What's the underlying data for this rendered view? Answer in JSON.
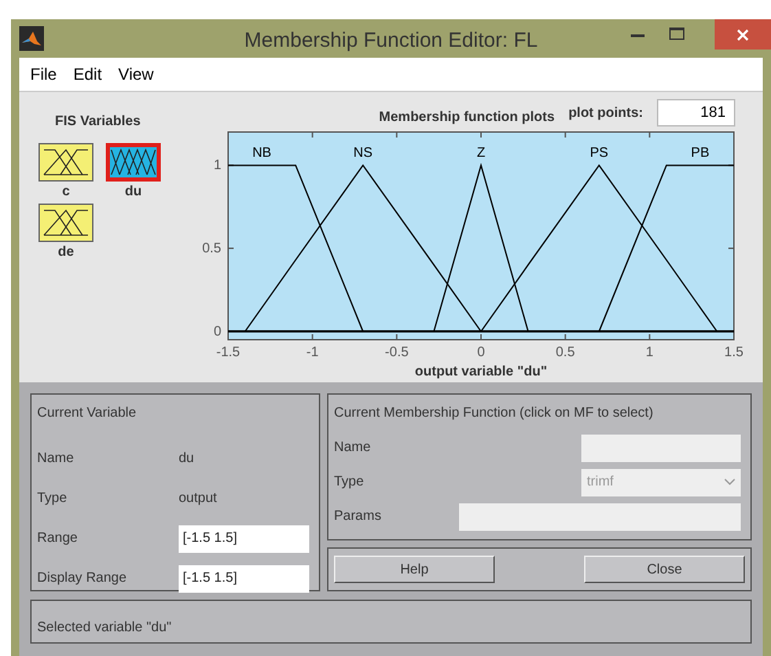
{
  "window": {
    "title": "Membership Function Editor: FL"
  },
  "menu": [
    "File",
    "Edit",
    "View"
  ],
  "fis_variables": {
    "title": "FIS Variables",
    "items": [
      {
        "name": "c",
        "kind": "input",
        "selected": false
      },
      {
        "name": "du",
        "kind": "output",
        "selected": true
      },
      {
        "name": "de",
        "kind": "input",
        "selected": false
      }
    ]
  },
  "plot_header": {
    "title": "Membership function plots",
    "points_label": "plot points:",
    "points_value": "181"
  },
  "chart_data": {
    "type": "line",
    "xlabel": "output variable \"du\"",
    "x": [
      -1.5,
      -1.4,
      -1.1,
      -0.7,
      -0.28,
      0,
      0.28,
      0.7,
      1.1,
      1.4,
      1.5
    ],
    "xlim": [
      -1.5,
      1.5
    ],
    "ylim": [
      -0.05,
      1.2
    ],
    "xticks": [
      -1.5,
      -1,
      -0.5,
      0,
      0.5,
      1,
      1.5
    ],
    "yticks": [
      0,
      0.5,
      1
    ],
    "series": [
      {
        "name": "NB",
        "color": "#000000",
        "values": [
          1,
          1,
          1,
          0,
          null,
          null,
          null,
          null,
          null,
          null,
          null
        ]
      },
      {
        "name": "NS",
        "color": "#000000",
        "values": [
          null,
          0,
          0.43,
          1,
          0.4,
          0,
          null,
          null,
          null,
          null,
          null
        ]
      },
      {
        "name": "Z",
        "color": "#000000",
        "values": [
          null,
          null,
          null,
          null,
          0,
          1,
          0,
          null,
          null,
          null,
          null
        ]
      },
      {
        "name": "PS",
        "color": "#000000",
        "values": [
          null,
          null,
          null,
          null,
          null,
          0,
          0.4,
          1,
          0.43,
          0,
          null
        ]
      },
      {
        "name": "PB",
        "color": "#000000",
        "values": [
          null,
          null,
          null,
          null,
          null,
          null,
          null,
          0,
          1,
          1,
          1
        ]
      }
    ]
  },
  "current_variable": {
    "title": "Current Variable",
    "rows": [
      {
        "kind": "text",
        "label": "Name",
        "value": "du"
      },
      {
        "kind": "text",
        "label": "Type",
        "value": "output"
      },
      {
        "kind": "field",
        "label": "Range",
        "value": "[-1.5 1.5]"
      },
      {
        "kind": "field",
        "label": "Display Range",
        "value": "[-1.5 1.5]"
      }
    ]
  },
  "current_mf": {
    "title": "Current Membership Function (click on MF to select)",
    "name_label": "Name",
    "type_label": "Type",
    "type_value": "trimf",
    "type_disabled": true,
    "params_label": "Params"
  },
  "buttons": [
    "Help",
    "Close"
  ],
  "status": "Selected variable \"du\""
}
